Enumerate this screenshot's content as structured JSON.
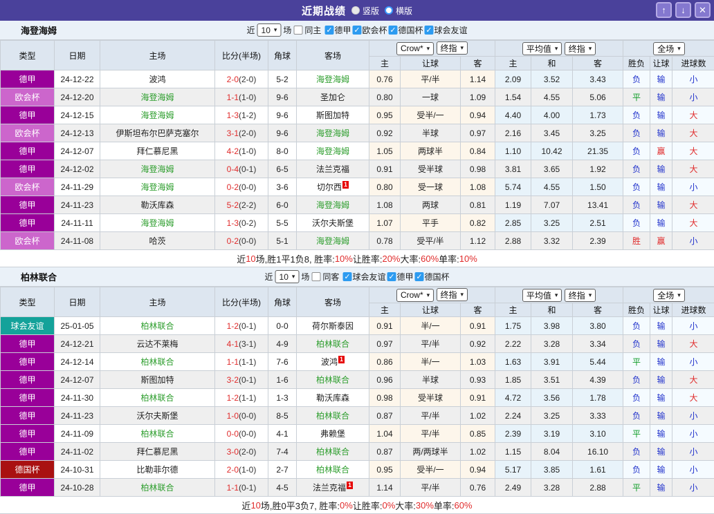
{
  "icons": {
    "up": "↑",
    "down": "↓",
    "close": "✕",
    "dropdown_arrow": "▾",
    "check": "✓"
  },
  "colors": {
    "titlebar": "#4A419B",
    "highlight_team": "#2E9E2E",
    "score": "#E02B2B",
    "league_dejia": "#990099",
    "league_ouhui": "#CC66CC",
    "league_deguobei": "#A91111",
    "league_youyi": "#14A29A"
  },
  "titlebar": {
    "title": "近期战绩",
    "radio_vertical": "竖版",
    "radio_horizontal": "横版"
  },
  "table_header": {
    "cols": {
      "type": "类型",
      "date": "日期",
      "home": "主场",
      "score": "比分(半场)",
      "corner": "角球",
      "away": "客场"
    },
    "groups": [
      {
        "dd": [
          "Crow*",
          "终指"
        ],
        "subs": [
          "主",
          "让球",
          "客"
        ]
      },
      {
        "dd": [
          "平均值",
          "终指"
        ],
        "subs": [
          "主",
          "和",
          "客"
        ]
      },
      {
        "dd": [
          "全场"
        ],
        "subs": [
          "胜负",
          "让球",
          "进球数"
        ]
      }
    ]
  },
  "sections": [
    {
      "team": "海登海姆",
      "filter": {
        "near": "近",
        "count": "10",
        "games": "场",
        "same": {
          "label": "同主",
          "checked": false
        },
        "leagues": [
          {
            "label": "德甲",
            "checked": true
          },
          {
            "label": "欧会杯",
            "checked": true
          },
          {
            "label": "德国杯",
            "checked": true
          },
          {
            "label": "球会友谊",
            "checked": true
          }
        ]
      },
      "rows": [
        {
          "league": "德甲",
          "league_color": "#990099",
          "date": "24-12-22",
          "home": "波鸿",
          "home_hl": false,
          "home_badge": "",
          "score": "2-0",
          "half": "(2-0)",
          "corner": "5-2",
          "away": "海登海姆",
          "away_hl": true,
          "away_badge": "",
          "odds": [
            "0.76",
            "平/半",
            "1.14",
            "2.09",
            "3.52",
            "3.43"
          ],
          "results": [
            {
              "t": "负",
              "c": "blue"
            },
            {
              "t": "输",
              "c": "blue"
            },
            {
              "t": "小",
              "c": "blue"
            }
          ]
        },
        {
          "league": "欧会杯",
          "league_color": "#CC66CC",
          "date": "24-12-20",
          "home": "海登海姆",
          "home_hl": true,
          "home_badge": "",
          "score": "1-1",
          "half": "(1-0)",
          "corner": "9-6",
          "away": "圣加仑",
          "away_hl": false,
          "away_badge": "",
          "odds": [
            "0.80",
            "一球",
            "1.09",
            "1.54",
            "4.55",
            "5.06"
          ],
          "results": [
            {
              "t": "平",
              "c": "green"
            },
            {
              "t": "输",
              "c": "blue"
            },
            {
              "t": "小",
              "c": "blue"
            }
          ]
        },
        {
          "league": "德甲",
          "league_color": "#990099",
          "date": "24-12-15",
          "home": "海登海姆",
          "home_hl": true,
          "home_badge": "",
          "score": "1-3",
          "half": "(1-2)",
          "corner": "9-6",
          "away": "斯图加特",
          "away_hl": false,
          "away_badge": "",
          "odds": [
            "0.95",
            "受半/一",
            "0.94",
            "4.40",
            "4.00",
            "1.73"
          ],
          "results": [
            {
              "t": "负",
              "c": "blue"
            },
            {
              "t": "输",
              "c": "blue"
            },
            {
              "t": "大",
              "c": "red"
            }
          ]
        },
        {
          "league": "欧会杯",
          "league_color": "#CC66CC",
          "date": "24-12-13",
          "home": "伊斯坦布尔巴萨克塞尔",
          "home_hl": false,
          "home_badge": "",
          "score": "3-1",
          "half": "(2-0)",
          "corner": "9-6",
          "away": "海登海姆",
          "away_hl": true,
          "away_badge": "",
          "odds": [
            "0.92",
            "半球",
            "0.97",
            "2.16",
            "3.45",
            "3.25"
          ],
          "results": [
            {
              "t": "负",
              "c": "blue"
            },
            {
              "t": "输",
              "c": "blue"
            },
            {
              "t": "大",
              "c": "red"
            }
          ]
        },
        {
          "league": "德甲",
          "league_color": "#990099",
          "date": "24-12-07",
          "home": "拜仁慕尼黑",
          "home_hl": false,
          "home_badge": "",
          "score": "4-2",
          "half": "(1-0)",
          "corner": "8-0",
          "away": "海登海姆",
          "away_hl": true,
          "away_badge": "",
          "odds": [
            "1.05",
            "两球半",
            "0.84",
            "1.10",
            "10.42",
            "21.35"
          ],
          "results": [
            {
              "t": "负",
              "c": "blue"
            },
            {
              "t": "赢",
              "c": "red"
            },
            {
              "t": "大",
              "c": "red"
            }
          ]
        },
        {
          "league": "德甲",
          "league_color": "#990099",
          "date": "24-12-02",
          "home": "海登海姆",
          "home_hl": true,
          "home_badge": "",
          "score": "0-4",
          "half": "(0-1)",
          "corner": "6-5",
          "away": "法兰克福",
          "away_hl": false,
          "away_badge": "",
          "odds": [
            "0.91",
            "受半球",
            "0.98",
            "3.81",
            "3.65",
            "1.92"
          ],
          "results": [
            {
              "t": "负",
              "c": "blue"
            },
            {
              "t": "输",
              "c": "blue"
            },
            {
              "t": "大",
              "c": "red"
            }
          ]
        },
        {
          "league": "欧会杯",
          "league_color": "#CC66CC",
          "date": "24-11-29",
          "home": "海登海姆",
          "home_hl": true,
          "home_badge": "",
          "score": "0-2",
          "half": "(0-0)",
          "corner": "3-6",
          "away": "切尔西",
          "away_hl": false,
          "away_badge": "1",
          "odds": [
            "0.80",
            "受一球",
            "1.08",
            "5.74",
            "4.55",
            "1.50"
          ],
          "results": [
            {
              "t": "负",
              "c": "blue"
            },
            {
              "t": "输",
              "c": "blue"
            },
            {
              "t": "小",
              "c": "blue"
            }
          ]
        },
        {
          "league": "德甲",
          "league_color": "#990099",
          "date": "24-11-23",
          "home": "勒沃库森",
          "home_hl": false,
          "home_badge": "",
          "score": "5-2",
          "half": "(2-2)",
          "corner": "6-0",
          "away": "海登海姆",
          "away_hl": true,
          "away_badge": "",
          "odds": [
            "1.08",
            "两球",
            "0.81",
            "1.19",
            "7.07",
            "13.41"
          ],
          "results": [
            {
              "t": "负",
              "c": "blue"
            },
            {
              "t": "输",
              "c": "blue"
            },
            {
              "t": "大",
              "c": "red"
            }
          ]
        },
        {
          "league": "德甲",
          "league_color": "#990099",
          "date": "24-11-11",
          "home": "海登海姆",
          "home_hl": true,
          "home_badge": "",
          "score": "1-3",
          "half": "(0-2)",
          "corner": "5-5",
          "away": "沃尔夫斯堡",
          "away_hl": false,
          "away_badge": "",
          "odds": [
            "1.07",
            "平手",
            "0.82",
            "2.85",
            "3.25",
            "2.51"
          ],
          "results": [
            {
              "t": "负",
              "c": "blue"
            },
            {
              "t": "输",
              "c": "blue"
            },
            {
              "t": "大",
              "c": "red"
            }
          ]
        },
        {
          "league": "欧会杯",
          "league_color": "#CC66CC",
          "date": "24-11-08",
          "home": "哈茨",
          "home_hl": false,
          "home_badge": "",
          "score": "0-2",
          "half": "(0-0)",
          "corner": "5-1",
          "away": "海登海姆",
          "away_hl": true,
          "away_badge": "",
          "odds": [
            "0.78",
            "受平/半",
            "1.12",
            "2.88",
            "3.32",
            "2.39"
          ],
          "results": [
            {
              "t": "胜",
              "c": "red"
            },
            {
              "t": "赢",
              "c": "red"
            },
            {
              "t": "小",
              "c": "blue"
            }
          ]
        }
      ],
      "summary": [
        {
          "t": "近",
          "red": false
        },
        {
          "t": "10",
          "red": true
        },
        {
          "t": "场,胜1平1负8, 胜率:",
          "red": false
        },
        {
          "t": "10%",
          "red": true
        },
        {
          "t": " 让胜率:",
          "red": false
        },
        {
          "t": "20%",
          "red": true
        },
        {
          "t": " 大率:",
          "red": false
        },
        {
          "t": "60%",
          "red": true
        },
        {
          "t": " 单率:",
          "red": false
        },
        {
          "t": "10%",
          "red": true
        }
      ]
    },
    {
      "team": "柏林联合",
      "filter": {
        "near": "近",
        "count": "10",
        "games": "场",
        "same": {
          "label": "同客",
          "checked": false
        },
        "leagues": [
          {
            "label": "球会友谊",
            "checked": true
          },
          {
            "label": "德甲",
            "checked": true
          },
          {
            "label": "德国杯",
            "checked": true
          }
        ]
      },
      "rows": [
        {
          "league": "球会友谊",
          "league_color": "#14A29A",
          "date": "25-01-05",
          "home": "柏林联合",
          "home_hl": true,
          "home_badge": "",
          "score": "1-2",
          "half": "(0-1)",
          "corner": "0-0",
          "away": "荷尔斯泰因",
          "away_hl": false,
          "away_badge": "",
          "odds": [
            "0.91",
            "半/一",
            "0.91",
            "1.75",
            "3.98",
            "3.80"
          ],
          "results": [
            {
              "t": "负",
              "c": "blue"
            },
            {
              "t": "输",
              "c": "blue"
            },
            {
              "t": "小",
              "c": "blue"
            }
          ]
        },
        {
          "league": "德甲",
          "league_color": "#990099",
          "date": "24-12-21",
          "home": "云达不莱梅",
          "home_hl": false,
          "home_badge": "",
          "score": "4-1",
          "half": "(3-1)",
          "corner": "4-9",
          "away": "柏林联合",
          "away_hl": true,
          "away_badge": "",
          "odds": [
            "0.97",
            "平/半",
            "0.92",
            "2.22",
            "3.28",
            "3.34"
          ],
          "results": [
            {
              "t": "负",
              "c": "blue"
            },
            {
              "t": "输",
              "c": "blue"
            },
            {
              "t": "大",
              "c": "red"
            }
          ]
        },
        {
          "league": "德甲",
          "league_color": "#990099",
          "date": "24-12-14",
          "home": "柏林联合",
          "home_hl": true,
          "home_badge": "",
          "score": "1-1",
          "half": "(1-1)",
          "corner": "7-6",
          "away": "波鸿",
          "away_hl": false,
          "away_badge": "1",
          "odds": [
            "0.86",
            "半/一",
            "1.03",
            "1.63",
            "3.91",
            "5.44"
          ],
          "results": [
            {
              "t": "平",
              "c": "green"
            },
            {
              "t": "输",
              "c": "blue"
            },
            {
              "t": "小",
              "c": "blue"
            }
          ]
        },
        {
          "league": "德甲",
          "league_color": "#990099",
          "date": "24-12-07",
          "home": "斯图加特",
          "home_hl": false,
          "home_badge": "",
          "score": "3-2",
          "half": "(0-1)",
          "corner": "1-6",
          "away": "柏林联合",
          "away_hl": true,
          "away_badge": "",
          "odds": [
            "0.96",
            "半球",
            "0.93",
            "1.85",
            "3.51",
            "4.39"
          ],
          "results": [
            {
              "t": "负",
              "c": "blue"
            },
            {
              "t": "输",
              "c": "blue"
            },
            {
              "t": "大",
              "c": "red"
            }
          ]
        },
        {
          "league": "德甲",
          "league_color": "#990099",
          "date": "24-11-30",
          "home": "柏林联合",
          "home_hl": true,
          "home_badge": "",
          "score": "1-2",
          "half": "(1-1)",
          "corner": "1-3",
          "away": "勒沃库森",
          "away_hl": false,
          "away_badge": "",
          "odds": [
            "0.98",
            "受半球",
            "0.91",
            "4.72",
            "3.56",
            "1.78"
          ],
          "results": [
            {
              "t": "负",
              "c": "blue"
            },
            {
              "t": "输",
              "c": "blue"
            },
            {
              "t": "大",
              "c": "red"
            }
          ]
        },
        {
          "league": "德甲",
          "league_color": "#990099",
          "date": "24-11-23",
          "home": "沃尔夫斯堡",
          "home_hl": false,
          "home_badge": "",
          "score": "1-0",
          "half": "(0-0)",
          "corner": "8-5",
          "away": "柏林联合",
          "away_hl": true,
          "away_badge": "",
          "odds": [
            "0.87",
            "平/半",
            "1.02",
            "2.24",
            "3.25",
            "3.33"
          ],
          "results": [
            {
              "t": "负",
              "c": "blue"
            },
            {
              "t": "输",
              "c": "blue"
            },
            {
              "t": "小",
              "c": "blue"
            }
          ]
        },
        {
          "league": "德甲",
          "league_color": "#990099",
          "date": "24-11-09",
          "home": "柏林联合",
          "home_hl": true,
          "home_badge": "",
          "score": "0-0",
          "half": "(0-0)",
          "corner": "4-1",
          "away": "弗赖堡",
          "away_hl": false,
          "away_badge": "",
          "odds": [
            "1.04",
            "平/半",
            "0.85",
            "2.39",
            "3.19",
            "3.10"
          ],
          "results": [
            {
              "t": "平",
              "c": "green"
            },
            {
              "t": "输",
              "c": "blue"
            },
            {
              "t": "小",
              "c": "blue"
            }
          ]
        },
        {
          "league": "德甲",
          "league_color": "#990099",
          "date": "24-11-02",
          "home": "拜仁慕尼黑",
          "home_hl": false,
          "home_badge": "",
          "score": "3-0",
          "half": "(2-0)",
          "corner": "7-4",
          "away": "柏林联合",
          "away_hl": true,
          "away_badge": "",
          "odds": [
            "0.87",
            "两/两球半",
            "1.02",
            "1.15",
            "8.04",
            "16.10"
          ],
          "results": [
            {
              "t": "负",
              "c": "blue"
            },
            {
              "t": "输",
              "c": "blue"
            },
            {
              "t": "小",
              "c": "blue"
            }
          ]
        },
        {
          "league": "德国杯",
          "league_color": "#A91111",
          "date": "24-10-31",
          "home": "比勒菲尔德",
          "home_hl": false,
          "home_badge": "",
          "score": "2-0",
          "half": "(1-0)",
          "corner": "2-7",
          "away": "柏林联合",
          "away_hl": true,
          "away_badge": "",
          "odds": [
            "0.95",
            "受半/一",
            "0.94",
            "5.17",
            "3.85",
            "1.61"
          ],
          "results": [
            {
              "t": "负",
              "c": "blue"
            },
            {
              "t": "输",
              "c": "blue"
            },
            {
              "t": "小",
              "c": "blue"
            }
          ]
        },
        {
          "league": "德甲",
          "league_color": "#990099",
          "date": "24-10-28",
          "home": "柏林联合",
          "home_hl": true,
          "home_badge": "",
          "score": "1-1",
          "half": "(0-1)",
          "corner": "4-5",
          "away": "法兰克福",
          "away_hl": false,
          "away_badge": "1",
          "odds": [
            "1.14",
            "平/半",
            "0.76",
            "2.49",
            "3.28",
            "2.88"
          ],
          "results": [
            {
              "t": "平",
              "c": "green"
            },
            {
              "t": "输",
              "c": "blue"
            },
            {
              "t": "小",
              "c": "blue"
            }
          ]
        }
      ],
      "summary": [
        {
          "t": "近",
          "red": false
        },
        {
          "t": "10",
          "red": true
        },
        {
          "t": "场,胜0平3负7, 胜率:",
          "red": false
        },
        {
          "t": "0%",
          "red": true
        },
        {
          "t": " 让胜率:",
          "red": false
        },
        {
          "t": "0%",
          "red": true
        },
        {
          "t": " 大率:",
          "red": false
        },
        {
          "t": "30%",
          "red": true
        },
        {
          "t": " 单率:",
          "red": false
        },
        {
          "t": "60%",
          "red": true
        }
      ]
    }
  ]
}
